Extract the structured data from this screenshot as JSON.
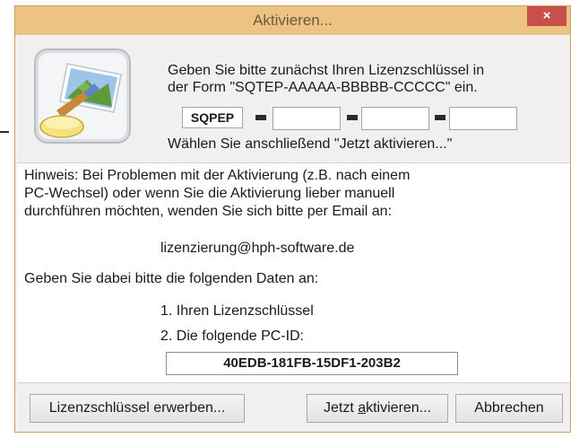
{
  "window": {
    "title": "Aktivieren...",
    "close_glyph": "×"
  },
  "intro": {
    "line1": "Geben Sie bitte zunächst Ihren Lizenzschlüssel in",
    "line2": "der Form \"SQTEP-AAAAA-BBBBB-CCCCC\" ein."
  },
  "license": {
    "prefix": "SQPEP",
    "field1": "",
    "field2": "",
    "field3": ""
  },
  "instruction": "Wählen Sie anschließend \"Jetzt aktivieren...\"",
  "info": {
    "hint_line1": "Hinweis: Bei Problemen mit der Aktivierung (z.B. nach einem",
    "hint_line2": "PC-Wechsel) oder wenn Sie die Aktivierung lieber manuell",
    "hint_line3": "durchführen möchten, wenden Sie sich bitte per Email an:",
    "email": "lizenzierung@hph-software.de",
    "give_data": "Geben Sie dabei bitte die folgenden Daten an:",
    "step1": "1. Ihren Lizenzschlüssel",
    "step2": "2. Die folgende PC-ID:",
    "pc_id": "40EDB-181FB-15DF1-203B2"
  },
  "buttons": {
    "acquire": "Lizenzschlüssel erwerben...",
    "activate_pre": "Jetzt ",
    "activate_underlined": "a",
    "activate_post": "ktivieren...",
    "cancel": "Abbrechen"
  },
  "icon": {
    "name": "paint-palette-icon"
  },
  "colors": {
    "titlebar": "#ecc383",
    "close": "#c7504c",
    "dialog_bg": "#f0f0f0"
  }
}
